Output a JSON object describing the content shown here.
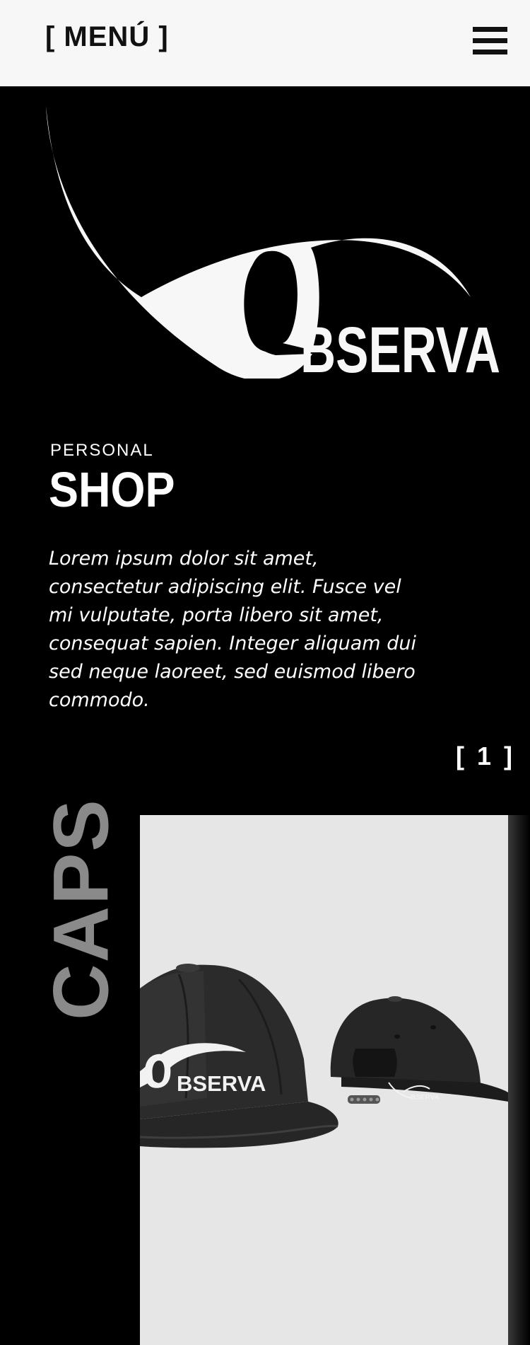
{
  "nav": {
    "menu_label": "[ MENÚ ]"
  },
  "brand": {
    "logo_text": "BSERVA"
  },
  "intro": {
    "eyebrow": "PERSONAL",
    "title": "SHOP",
    "description": "Lorem ipsum dolor sit amet, consectetur adipiscing elit.  Fusce vel mi vulputate, porta libero sit amet, consequat sapien. Integer aliquam dui sed neque laoreet, sed euismod libero commodo."
  },
  "pager": {
    "label": "[ 1 ]"
  },
  "category": {
    "label": "CAPS",
    "product_logo_front": "BSERVA",
    "product_logo_back": "BSERVA"
  },
  "colors": {
    "background": "#000000",
    "topbar": "#f7f7f7",
    "category_label": "#8a8a8a",
    "product_bg": "#e6e6e6"
  }
}
